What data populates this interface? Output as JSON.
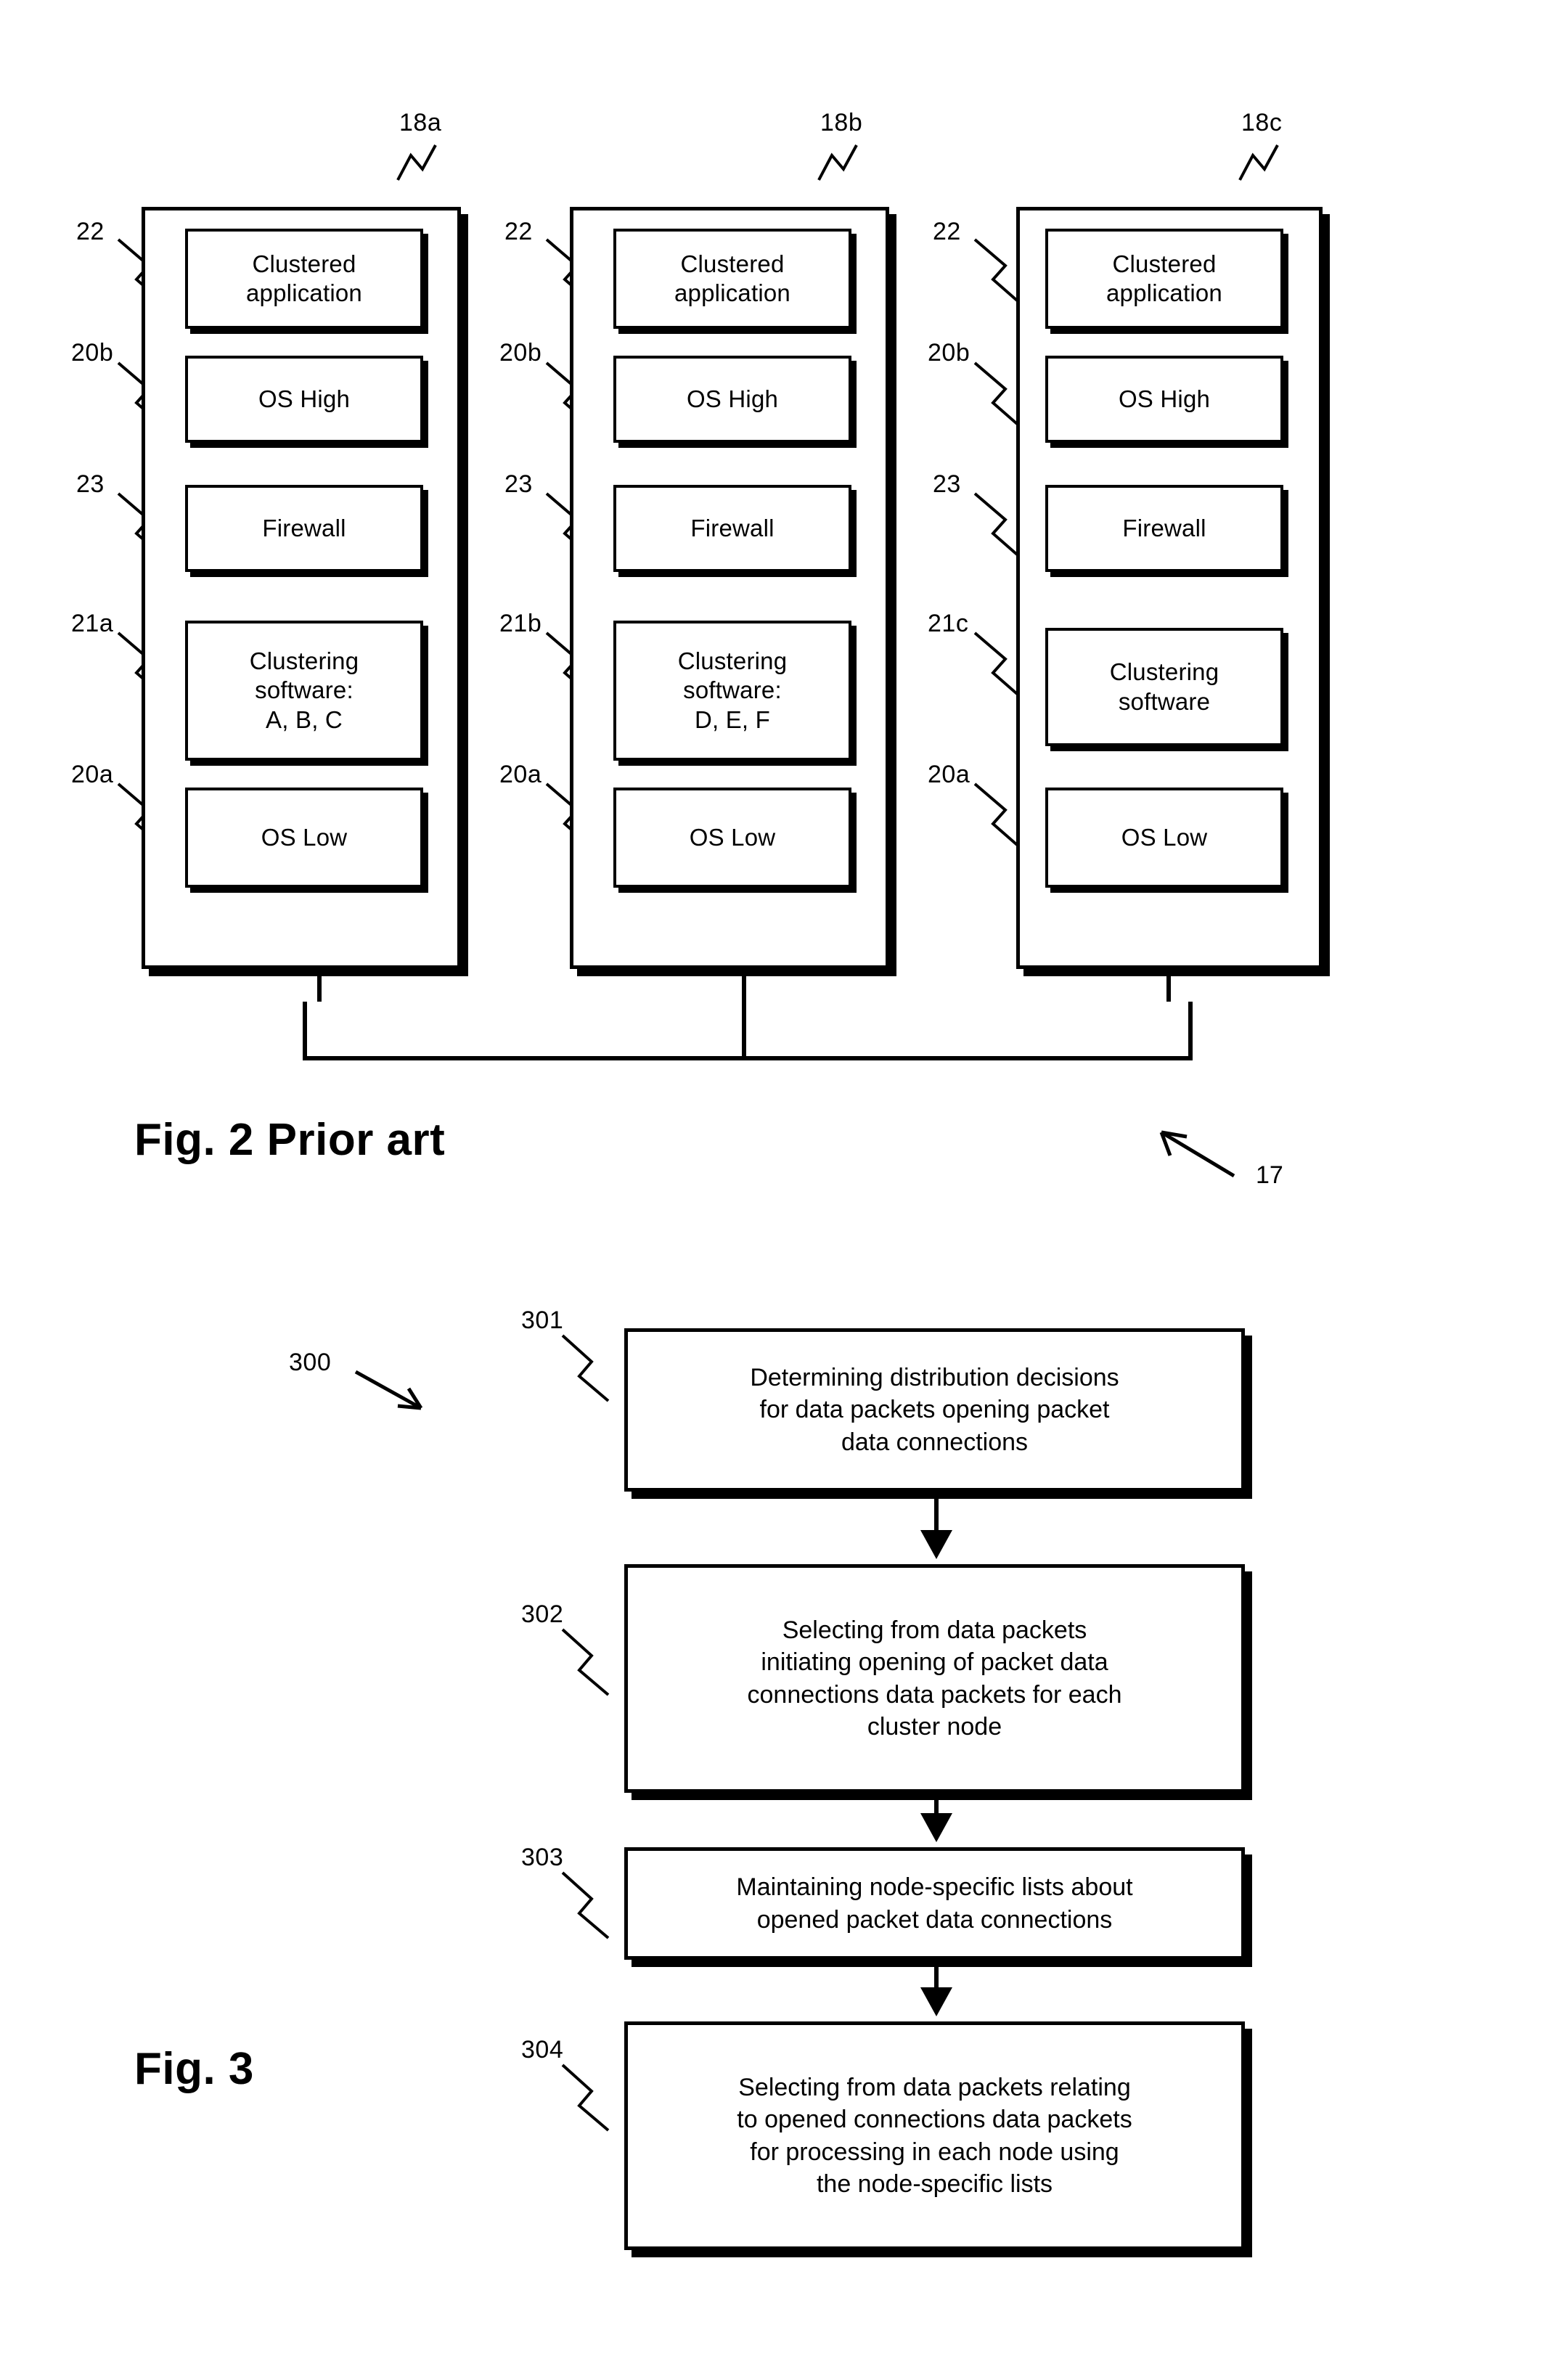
{
  "figure2": {
    "caption": "Fig. 2 Prior art",
    "bus_ref": "17",
    "nodes": [
      {
        "node_ref": "18a",
        "labels": {
          "application": "22",
          "os_high": "20b",
          "firewall": "23",
          "clustering": "21a",
          "os_low": "20a"
        },
        "blocks": [
          {
            "name": "clustered-application",
            "lines": [
              "Clustered",
              "application"
            ]
          },
          {
            "name": "os-high",
            "lines": [
              "OS High"
            ]
          },
          {
            "name": "firewall",
            "lines": [
              "Firewall"
            ]
          },
          {
            "name": "clustering-software",
            "lines": [
              "Clustering",
              "software:",
              "A, B, C"
            ]
          },
          {
            "name": "os-low",
            "lines": [
              "OS Low"
            ]
          }
        ]
      },
      {
        "node_ref": "18b",
        "labels": {
          "application": "22",
          "os_high": "20b",
          "firewall": "23",
          "clustering": "21b",
          "os_low": "20a"
        },
        "blocks": [
          {
            "name": "clustered-application",
            "lines": [
              "Clustered",
              "application"
            ]
          },
          {
            "name": "os-high",
            "lines": [
              "OS High"
            ]
          },
          {
            "name": "firewall",
            "lines": [
              "Firewall"
            ]
          },
          {
            "name": "clustering-software",
            "lines": [
              "Clustering",
              "software:",
              "D, E, F"
            ]
          },
          {
            "name": "os-low",
            "lines": [
              "OS Low"
            ]
          }
        ]
      },
      {
        "node_ref": "18c",
        "labels": {
          "application": "22",
          "os_high": "20b",
          "firewall": "23",
          "clustering": "21c",
          "os_low": "20a"
        },
        "blocks": [
          {
            "name": "clustered-application",
            "lines": [
              "Clustered",
              "application"
            ]
          },
          {
            "name": "os-high",
            "lines": [
              "OS High"
            ]
          },
          {
            "name": "firewall",
            "lines": [
              "Firewall"
            ]
          },
          {
            "name": "clustering-software",
            "lines": [
              "Clustering",
              "software"
            ]
          },
          {
            "name": "os-low",
            "lines": [
              "OS Low"
            ]
          }
        ]
      }
    ]
  },
  "figure3": {
    "caption": "Fig. 3",
    "diagram_ref": "300",
    "steps": [
      {
        "ref": "301",
        "name": "determining-distribution-decisions",
        "lines": [
          "Determining distribution decisions",
          "for data packets opening packet",
          "data connections"
        ]
      },
      {
        "ref": "302",
        "name": "selecting-initiating-packets",
        "lines": [
          "Selecting from data packets",
          "initiating opening of packet data",
          "connections data packets for each",
          "cluster node"
        ]
      },
      {
        "ref": "303",
        "name": "maintaining-node-specific-lists",
        "lines": [
          "Maintaining node-specific lists about",
          "opened  packet data connections"
        ]
      },
      {
        "ref": "304",
        "name": "selecting-opened-connection-packets",
        "lines": [
          "Selecting from data packets relating",
          "to opened connections data packets",
          "for processing in each node  using",
          "the node-specific lists"
        ]
      }
    ]
  }
}
